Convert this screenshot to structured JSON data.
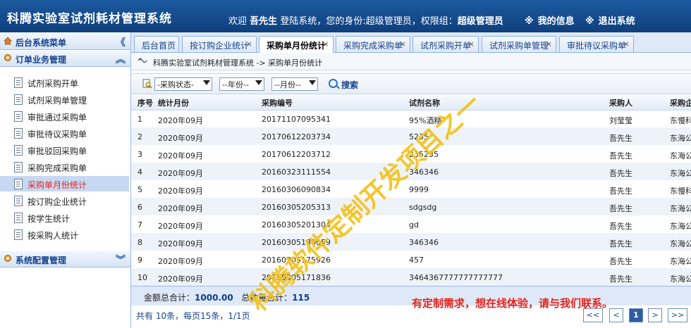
{
  "header": {
    "app_title": "科腾实验室试剂耗材管理系统",
    "welcome_prefix": "欢迎",
    "user": "吾先生",
    "welcome_mid": "登陆系统，您的身份:超级管理员，权限组：",
    "role_group": "超级管理员",
    "my_info": "我的信息",
    "logout": "退出系统",
    "link_mark": "※"
  },
  "sidebar": {
    "menu_title": "后台系统菜单",
    "collapse_glyph": "《",
    "order_section": "订单业务管理",
    "order_tool": "︽",
    "items": [
      {
        "label": "试剂采购开单"
      },
      {
        "label": "试剂采购单管理"
      },
      {
        "label": "审批通过采购单"
      },
      {
        "label": "审批待议采购单"
      },
      {
        "label": "审批驳回采购单"
      },
      {
        "label": "采购完成采购单"
      },
      {
        "label": "采购单月份统计"
      },
      {
        "label": "按订购企业统计"
      },
      {
        "label": "按学生统计"
      },
      {
        "label": "按采购人统计"
      }
    ],
    "config_section": "系统配置管理",
    "config_tool": "︾"
  },
  "tabs": [
    {
      "label": "后台首页",
      "closable": false
    },
    {
      "label": "按订购企业统计",
      "closable": true
    },
    {
      "label": "采购单月份统计",
      "closable": true
    },
    {
      "label": "采购完成采购单",
      "closable": true
    },
    {
      "label": "试剂采购开单",
      "closable": true
    },
    {
      "label": "试剂采购单管理",
      "closable": true
    },
    {
      "label": "审批待议采购单",
      "closable": true
    }
  ],
  "tab_close_glyph": "×",
  "breadcrumb": "科腾实验室试剂耗材管理系统 -> 采购单月份统计",
  "filters": {
    "status": "-采购状态-",
    "year": "--年份--",
    "month": "--月份--",
    "search_label": "搜索"
  },
  "table": {
    "headers": [
      "序号",
      "统计月份",
      "采购编号",
      "试剂名称",
      "采购人",
      "采购企"
    ],
    "rows": [
      [
        "1",
        "2020年09月",
        "20171107095341",
        "95%酒精",
        "刘莹莹",
        "东慢科"
      ],
      [
        "2",
        "2020年09月",
        "20170612203734",
        "5235",
        "吾先生",
        "东海公"
      ],
      [
        "3",
        "2020年09月",
        "20170612203712",
        "235235",
        "吾先生",
        "东海公"
      ],
      [
        "4",
        "2020年09月",
        "20160323111554",
        "346346",
        "吾先生",
        "东海公"
      ],
      [
        "5",
        "2020年09月",
        "20160306090834",
        "9999",
        "吾先生",
        "东慢科"
      ],
      [
        "6",
        "2020年09月",
        "20160305205313",
        "sdgsdg",
        "吾先生",
        "东海公"
      ],
      [
        "7",
        "2020年09月",
        "20160305201304",
        "gd",
        "吾先生",
        "东海公"
      ],
      [
        "8",
        "2020年09月",
        "20160305180059",
        "346346",
        "吾先生",
        "东海公"
      ],
      [
        "9",
        "2020年09月",
        "20160305175926",
        "457",
        "吾先生",
        "东海公"
      ],
      [
        "10",
        "2020年09月",
        "20160305171836",
        "3464367777777777777",
        "吾先生",
        "东海公"
      ]
    ]
  },
  "summary": {
    "amount_label": "金额总合计：",
    "amount": "1000.00",
    "qty_label": "总数量合计：",
    "qty": "115"
  },
  "pager": {
    "text": "共有 10条，每页15条，1/1页",
    "first": "<<",
    "prev": "<",
    "current": "1",
    "next": ">",
    "last": ">>"
  },
  "watermark": "科腾软件定制开发项目之一",
  "contact_note": "有定制需求，想在线体验，请与我们联系。",
  "colors": {
    "header_bg": "#15498c",
    "active_menu_text": "#e8231c",
    "watermark": "#f3c322"
  }
}
